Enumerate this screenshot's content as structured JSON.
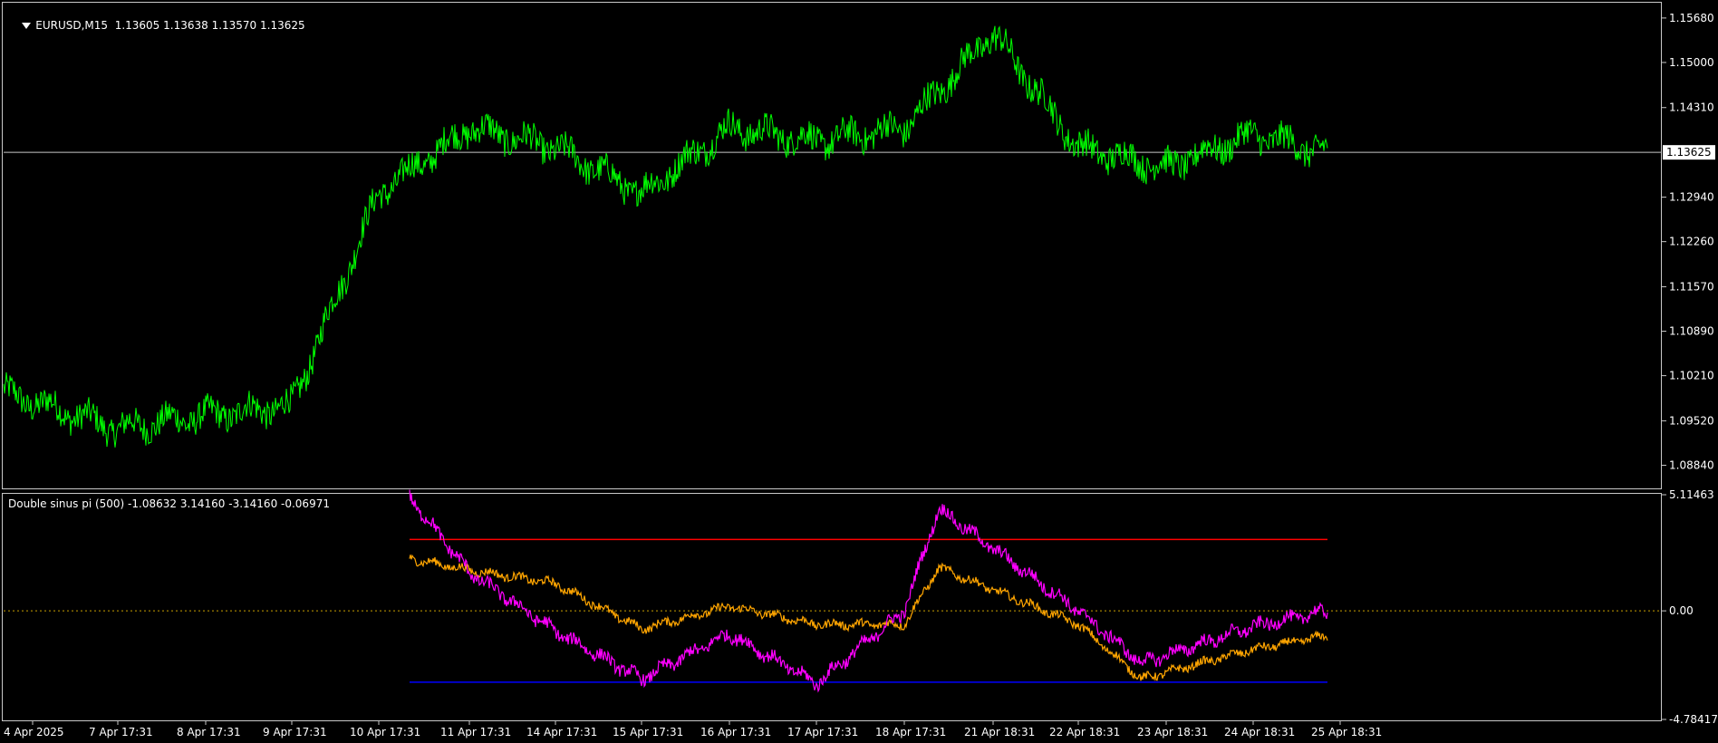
{
  "main": {
    "symbol": "EURUSD,M15",
    "quote": "1.13605 1.13638 1.13570 1.13625",
    "price_ticks": [
      "1.15680",
      "1.15000",
      "1.14310",
      "1.13625",
      "1.12940",
      "1.12260",
      "1.11570",
      "1.10890",
      "1.10210",
      "1.09520",
      "1.08840"
    ],
    "current_price": "1.13625"
  },
  "indicator": {
    "header": "Double sinus pi (500) -1.08632 3.14160 -3.14160 -0.06971",
    "ticks": [
      "5.11463",
      "0.00",
      "-4.78417"
    ],
    "levels": {
      "upper": 3.1416,
      "lower": -3.1416,
      "zero": 0.0
    }
  },
  "time_labels": [
    "4 Apr 2025",
    "7 Apr 17:31",
    "8 Apr 17:31",
    "9 Apr 17:31",
    "10 Apr 17:31",
    "11 Apr 17:31",
    "14 Apr 17:31",
    "15 Apr 17:31",
    "16 Apr 17:31",
    "17 Apr 17:31",
    "18 Apr 17:31",
    "21 Apr 18:31",
    "22 Apr 18:31",
    "23 Apr 18:31",
    "24 Apr 18:31",
    "25 Apr 18:31"
  ],
  "colors": {
    "price": "#00ff00",
    "fast": "#ff00ff",
    "slow": "#ffa500",
    "upper": "#ff0000",
    "lower": "#0000ff",
    "axis": "#c8c8c8"
  },
  "chart_data": [
    {
      "type": "line",
      "title": "EURUSD,M15",
      "ylim": [
        1.085,
        1.159
      ],
      "x": [
        "4 Apr 2025",
        "7 Apr 17:31",
        "8 Apr 17:31",
        "9 Apr 17:31",
        "10 Apr 17:31",
        "11 Apr 17:31",
        "14 Apr 17:31",
        "15 Apr 17:31",
        "16 Apr 17:31",
        "17 Apr 17:31",
        "18 Apr 17:31",
        "21 Apr 18:31",
        "22 Apr 18:31",
        "23 Apr 18:31",
        "24 Apr 18:31",
        "25 Apr 18:31"
      ],
      "series": [
        {
          "values": [
            1.0995,
            1.094,
            1.096,
            1.0975,
            1.13,
            1.14,
            1.137,
            1.13,
            1.14,
            1.138,
            1.14,
            1.1545,
            1.137,
            1.134,
            1.139,
            1.1362
          ]
        }
      ]
    },
    {
      "type": "line",
      "title": "Double sinus pi (500) -1.08632 3.14160 -3.14160 -0.06971",
      "ylim": [
        -4.78417,
        5.11463
      ],
      "x": [
        "10 Apr 17:31",
        "11 Apr 17:31",
        "14 Apr 17:31",
        "15 Apr 17:31",
        "16 Apr 17:31",
        "17 Apr 17:31",
        "18 Apr 17:31",
        "21 Apr 18:31",
        "22 Apr 18:31",
        "23 Apr 18:31",
        "24 Apr 18:31",
        "25 Apr 18:31"
      ],
      "series": [
        {
          "values": [
            5.0,
            1.7,
            -0.9,
            -3.0,
            -1.0,
            -3.2,
            0.0,
            4.5,
            0.0,
            -2.3,
            -0.7,
            0.0
          ]
        },
        {
          "values": [
            2.3,
            1.8,
            1.2,
            -0.8,
            0.2,
            -0.6,
            -0.6,
            1.9,
            -0.6,
            -3.0,
            -1.7,
            -1.1
          ]
        }
      ],
      "levels": [
        3.1416,
        0.0,
        -3.1416
      ]
    }
  ]
}
